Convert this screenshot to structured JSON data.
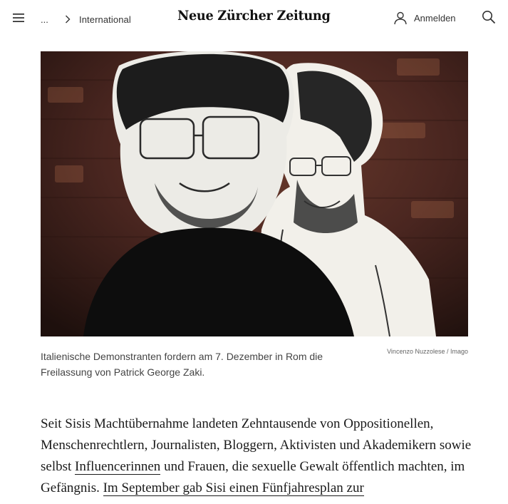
{
  "header": {
    "menu_icon": "hamburger-menu-icon",
    "breadcrumb_ellipsis": "...",
    "breadcrumb_section": "International",
    "logo": "Neue Zürcher Zeitung",
    "login_label": "Anmelden",
    "search_icon": "search-icon"
  },
  "hero": {
    "caption": "Italienische Demonstranten fordern am 7. Dezember in Rom die Freilassung von Patrick George Zaki.",
    "credit": "Vincenzo Nuzzolese / Imago"
  },
  "article": {
    "line1": "Seit Sisis Machtübernahme landeten Zehntausende von Oppositionellen, Menschenrechtlern, Journalisten, Bloggern, Aktivisten und Akademikern sowie selbst ",
    "link1": "Influencerinnen",
    "line2": " und Frauen, die sexuelle Gewalt öffentlich machten, im Gefängnis. ",
    "link2": "Im September gab Sisi einen Fünfjahresplan zur"
  },
  "colors": {
    "text": "#1f1f1f",
    "muted": "#444444",
    "background": "#ffffff"
  }
}
